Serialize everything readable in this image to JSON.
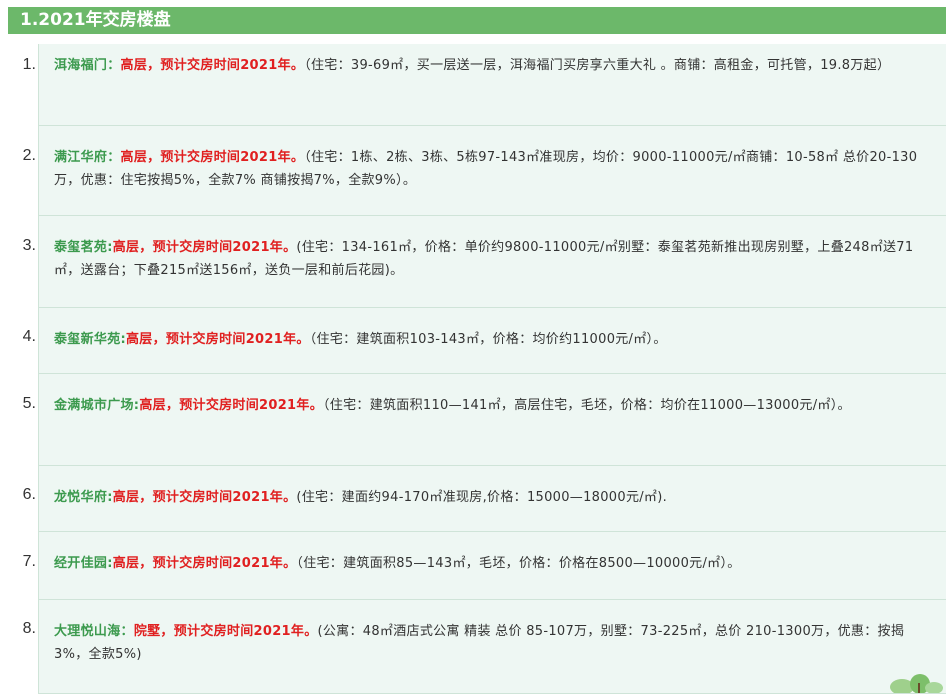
{
  "header": {
    "title": "1.2021年交房楼盘"
  },
  "items": [
    {
      "num": "1.",
      "name": "洱海福门：",
      "tag": "高层，预计交房时间2021年。",
      "detail": "（住宅：39-69㎡，买一层送一层，洱海福门买房享六重大礼 。商铺：高租金，可托管，19.8万起）"
    },
    {
      "num": "2.",
      "name": "满江华府：",
      "tag": "高层，预计交房时间2021年。",
      "detail": "（住宅：1栋、2栋、3栋、5栋97-143㎡准现房，均价：9000-11000元/㎡商铺：10-58㎡ 总价20-130万，优惠：住宅按揭5%，全款7%  商铺按揭7%，全款9%）。"
    },
    {
      "num": "3.",
      "name": "泰玺茗苑:",
      "tag": "高层，预计交房时间2021年。",
      "detail": "(住宅：134-161㎡，价格：单价约9800-11000元/㎡别墅：泰玺茗苑新推出现房别墅，上叠248㎡送71㎡，送露台；下叠215㎡送156㎡，送负一层和前后花园)。"
    },
    {
      "num": "4.",
      "name": "泰玺新华苑:",
      "tag": "高层，预计交房时间2021年。",
      "detail": "（住宅：建筑面积103-143㎡，价格：均价约11000元/㎡）。"
    },
    {
      "num": "5.",
      "name": "金满城市广场:",
      "tag": "高层，预计交房时间2021年。",
      "detail": "（住宅：建筑面积110—141㎡，高层住宅，毛坯，价格：均价在11000—13000元/㎡）。"
    },
    {
      "num": "6.",
      "name": "龙悦华府:",
      "tag": "高层，预计交房时间2021年。",
      "detail": "(住宅：建面约94-170㎡准现房,价格：15000—18000元/㎡)."
    },
    {
      "num": "7.",
      "name": "经开佳园:",
      "tag": "高层，预计交房时间2021年。",
      "detail": "（住宅：建筑面积85—143㎡，毛坯，价格：价格在8500—10000元/㎡）。"
    },
    {
      "num": "8.",
      "name": "大理悦山海：",
      "tag": "院墅，预计交房时间2021年。",
      "detail": "(公寓：48㎡酒店式公寓 精装  总价 85-107万，别墅：73-225㎡，总价 210-1300万，优惠：按揭3%，全款5%)"
    }
  ]
}
